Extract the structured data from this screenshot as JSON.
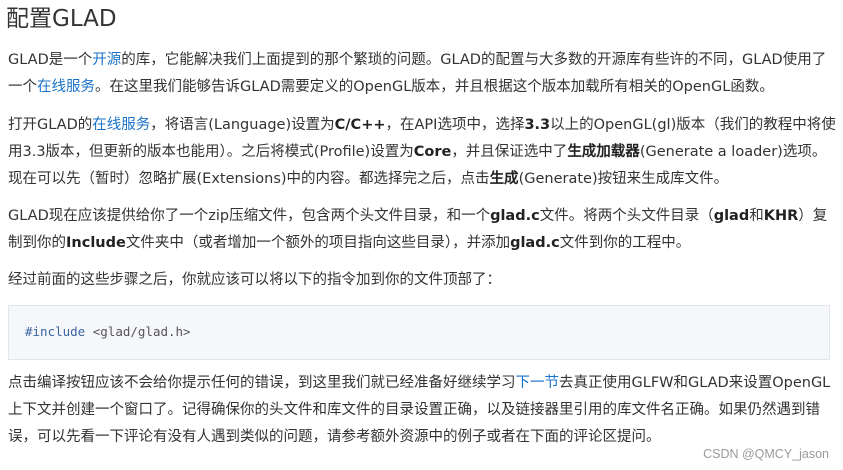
{
  "title": "配置GLAD",
  "p1": {
    "t1": "GLAD是一个",
    "link1": "开源",
    "t2": "的库，它能解决我们上面提到的那个繁琐的问题。GLAD的配置与大多数的开源库有些许的不同，GLAD使用了一个",
    "link2": "在线服务",
    "t3": "。在这里我们能够告诉GLAD需要定义的OpenGL版本，并且根据这个版本加载所有相关的OpenGL函数。"
  },
  "p2": {
    "t1": "打开GLAD的",
    "link1": "在线服务",
    "t2": "，将语言(Language)设置为",
    "b1": "C/C++",
    "t3": "，在API选项中，选择",
    "b2": "3.3",
    "t4": "以上的OpenGL(gl)版本（我们的教程中将使用3.3版本，但更新的版本也能用）。之后将模式(Profile)设置为",
    "b3": "Core",
    "t5": "，并且保证选中了",
    "b4": "生成加载器",
    "t6": "(Generate a loader)选项。现在可以先（暂时）忽略扩展(Extensions)中的内容。都选择完之后，点击",
    "b5": "生成",
    "t7": "(Generate)按钮来生成库文件。"
  },
  "p3": {
    "t1": "GLAD现在应该提供给你了一个zip压缩文件，包含两个头文件目录，和一个",
    "b1": "glad.c",
    "t2": "文件。将两个头文件目录（",
    "b2": "glad",
    "t3": "和",
    "b3": "KHR",
    "t4": "）复制到你的",
    "b4": "Include",
    "t5": "文件夹中（或者增加一个额外的项目指向这些目录），并添加",
    "b5": "glad.c",
    "t6": "文件到你的工程中。"
  },
  "p4": {
    "t1": "经过前面的这些步骤之后，你就应该可以将以下的指令加到你的文件顶部了："
  },
  "code": {
    "keyword": "#include",
    "rest": " <glad/glad.h>"
  },
  "p5": {
    "t1": "点击编译按钮应该不会给你提示任何的错误，到这里我们就已经准备好继续学习",
    "link1": "下一节",
    "t2": "去真正使用GLFW和GLAD来设置OpenGL上下文并创建一个窗口了。记得确保你的头文件和库文件的目录设置正确，以及链接器里引用的库文件名正确。如果仍然遇到错误，可以先看一下评论有没有人遇到类似的问题，请参考额外资源中的例子或者在下面的评论区提问。"
  },
  "watermark": "CSDN @QMCY_jason",
  "colors": {
    "link": "#1a73c8",
    "text": "#333333",
    "code_bg": "#f5f7fa"
  }
}
